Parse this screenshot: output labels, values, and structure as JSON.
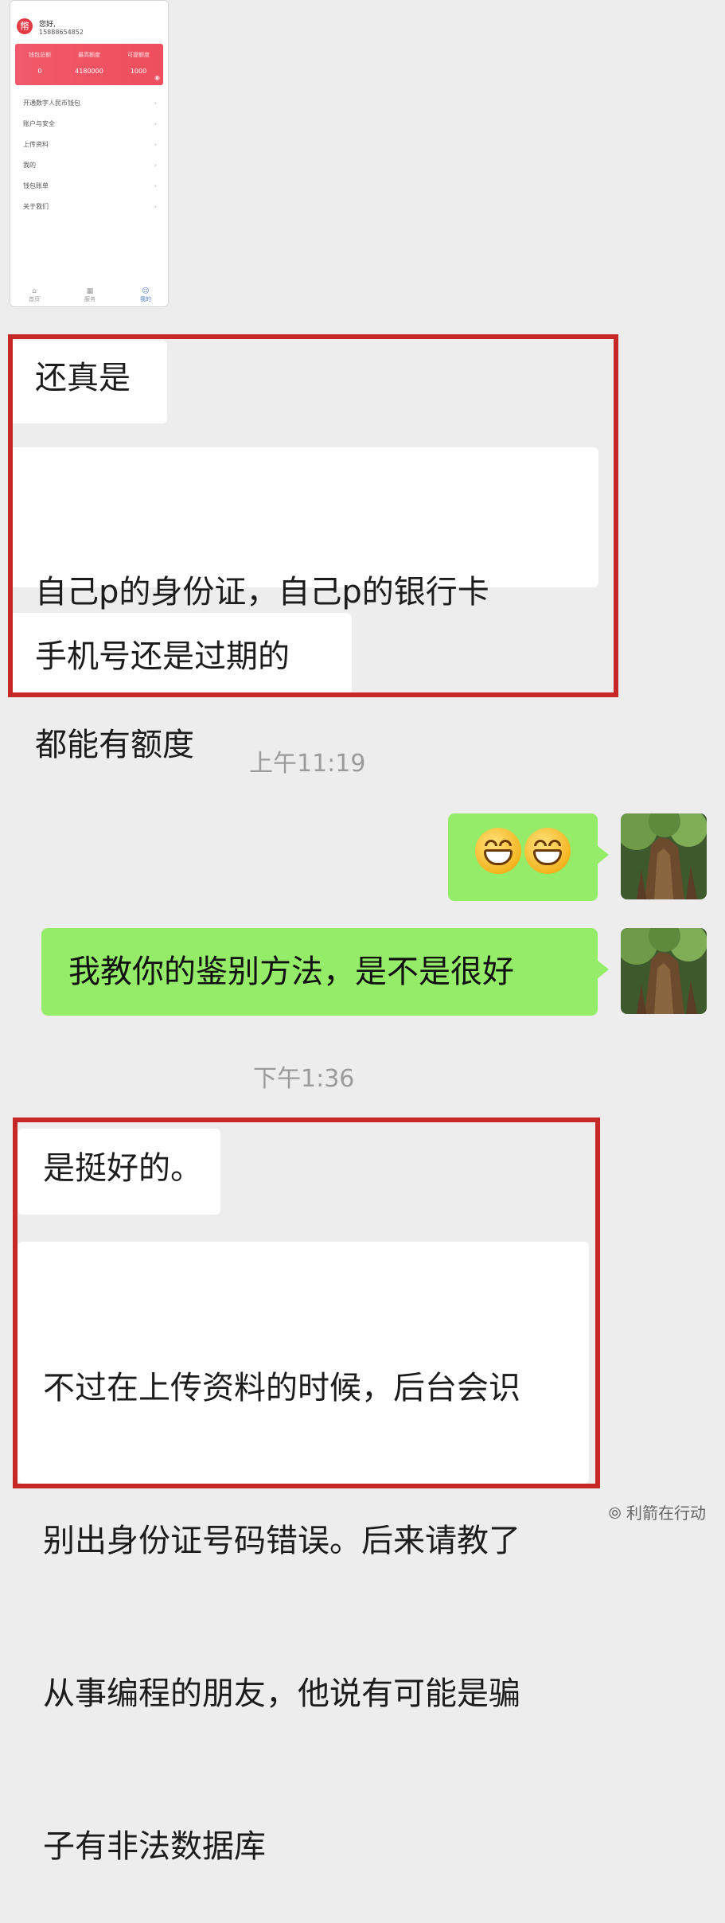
{
  "embedded_app": {
    "greeting": "您好,",
    "phone": "15888654852",
    "logo_glyph": "幣",
    "stats": [
      {
        "label": "钱包总额",
        "value": "0"
      },
      {
        "label": "最高额度",
        "value": "4180000"
      },
      {
        "label": "可提额度",
        "value": "1000"
      }
    ],
    "menu": [
      "开通数字人民币钱包",
      "账户与安全",
      "上传资料",
      "我的",
      "钱包账单",
      "关于我们"
    ],
    "tabs": [
      "首页",
      "服务",
      "我的"
    ]
  },
  "messages": {
    "m1": "还真是",
    "m2_line1": "自己p的身份证，自己p的银行卡",
    "m2_line2": "都能有额度",
    "m3": "手机号还是过期的",
    "t1": "上午11:19",
    "m5": "我教你的鉴别方法，是不是很好",
    "t2": "下午1:36",
    "m6": "是挺好的。",
    "m7_line1": "不过在上传资料的时候，后台会识",
    "m7_line2": "别出身份证号码错误。后来请教了",
    "m7_line3": "从事编程的朋友，他说有可能是骗",
    "m7_line4": "子有非法数据库"
  },
  "emoji_name": "grin-emoji",
  "watermark": "利箭在行动",
  "colors": {
    "highlight_box": "#c62828",
    "outgoing_bubble": "#95ec69",
    "incoming_bubble": "#ffffff",
    "background": "#ededed"
  }
}
